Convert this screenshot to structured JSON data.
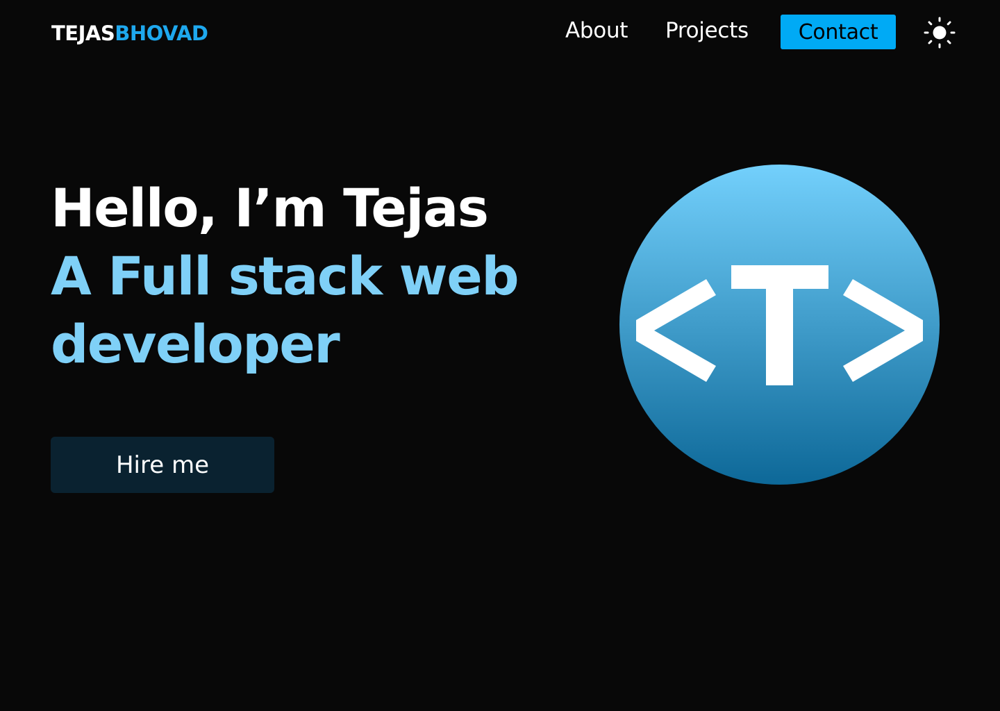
{
  "header": {
    "logo_first": "TEJAS",
    "logo_last": "BHOVAD",
    "nav": {
      "about": "About",
      "projects": "Projects",
      "contact": "Contact"
    },
    "theme_icon": "sun-icon"
  },
  "hero": {
    "greeting": "Hello, I’m Tejas",
    "role_line_1": "A Full stack web",
    "role_line_2": "developer",
    "hire_label": "Hire me"
  },
  "logo_mark": {
    "icon": "code-tag-t-logo",
    "gradient_top": "#73d0fc",
    "gradient_bottom": "#0d6898"
  },
  "colors": {
    "background": "#080808",
    "accent": "#00aaf5",
    "logo_last": "#1ea8ee",
    "role_text": "#7fd0f7",
    "hire_button_bg": "#0a2230"
  }
}
